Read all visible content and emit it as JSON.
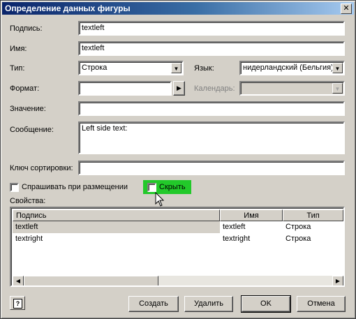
{
  "window": {
    "title": "Определение данных фигуры",
    "close_glyph": "✕"
  },
  "form": {
    "caption_label": "Подпись:",
    "caption_value": "textleft",
    "name_label": "Имя:",
    "name_value": "textleft",
    "type_label": "Тип:",
    "type_value": "Строка",
    "language_label": "Язык:",
    "language_value": "нидерландский (Бельгия)",
    "format_label": "Формат:",
    "format_value": "",
    "calendar_label": "Календарь:",
    "calendar_value": "",
    "value_label": "Значение:",
    "value_value": "",
    "message_label": "Сообщение:",
    "message_value": "Left side text:",
    "sortkey_label": "Ключ сортировки:",
    "sortkey_value": "",
    "ask_on_drop_label": "Спрашивать при размещении",
    "hide_label": "Скрыть"
  },
  "properties": {
    "label": "Свойства:",
    "columns": [
      "Подпись",
      "Имя",
      "Тип"
    ],
    "rows": [
      {
        "caption": "textleft",
        "name": "textleft",
        "type": "Строка",
        "selected": true
      },
      {
        "caption": "textright",
        "name": "textright",
        "type": "Строка",
        "selected": false
      }
    ]
  },
  "buttons": {
    "help": "?",
    "create": "Создать",
    "delete": "Удалить",
    "ok": "OK",
    "cancel": "Отмена"
  },
  "colors": {
    "title_bar": "#0a246a",
    "face": "#d4d0c8",
    "highlight": "#22c92a"
  },
  "icons": {
    "dropdown": "▼",
    "arrow_right": "▶",
    "scroll_left": "◀",
    "scroll_right": "▶"
  }
}
